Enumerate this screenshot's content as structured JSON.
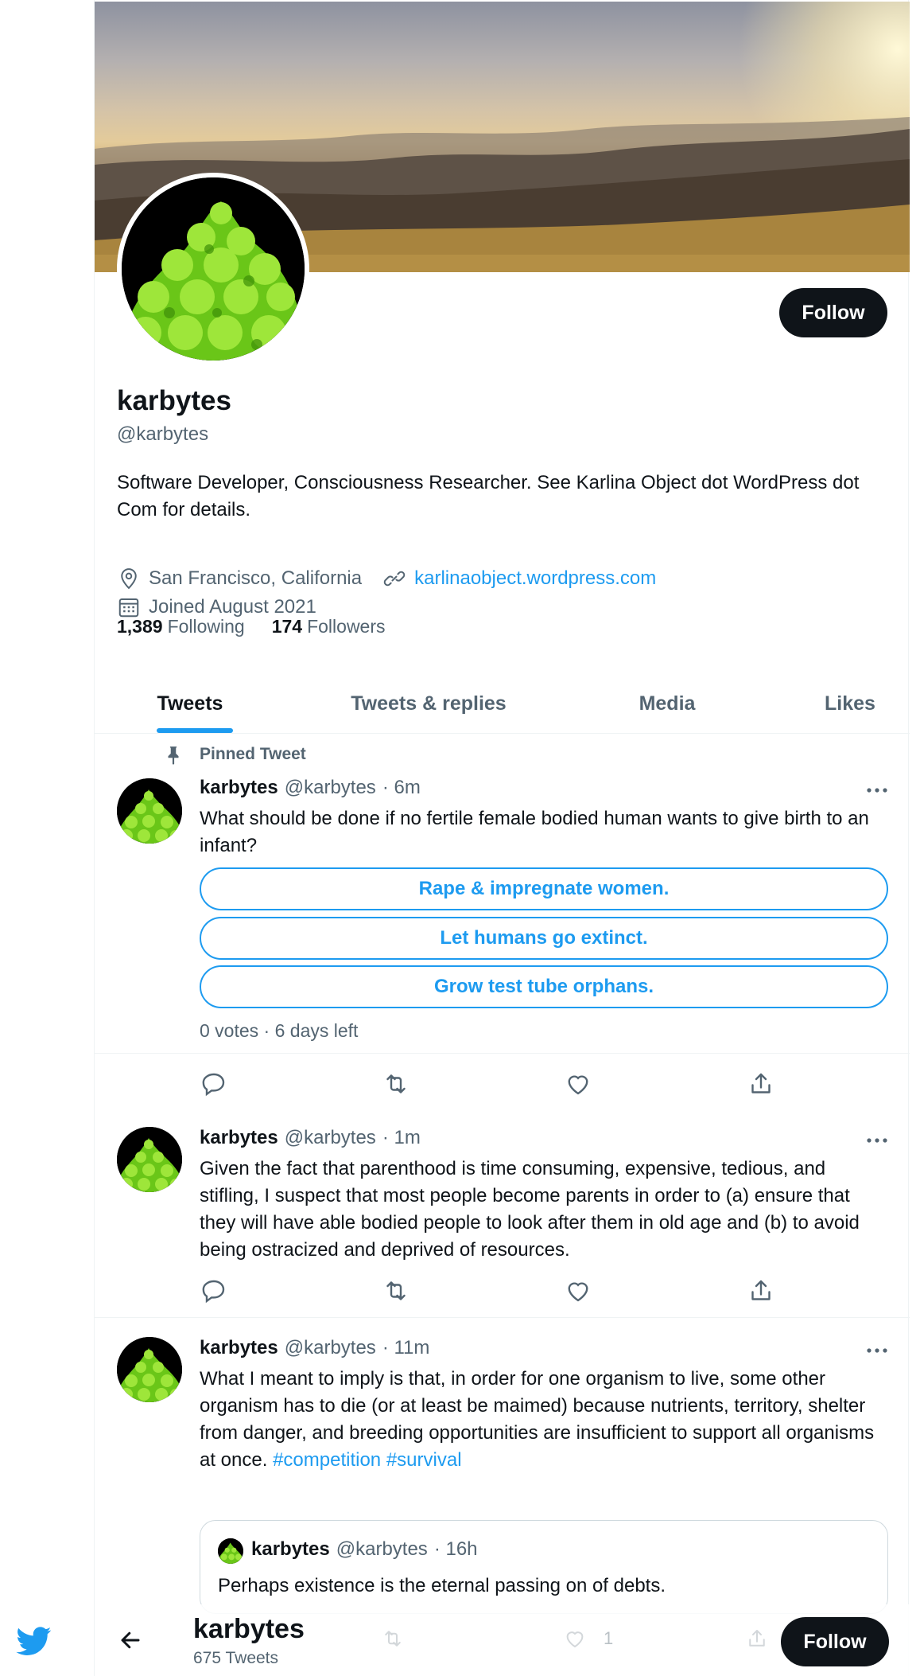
{
  "profile": {
    "name": "karbytes",
    "handle": "@karbytes",
    "bio": "Software Developer, Consciousness Researcher. See Karlina Object dot WordPress dot Com for details.",
    "location": "San Francisco, California",
    "website": "karlinaobject.wordpress.com",
    "joined": "Joined August 2021",
    "following_count": "1,389",
    "following_label": "Following",
    "followers_count": "174",
    "followers_label": "Followers",
    "follow_label": "Follow"
  },
  "tabs": [
    {
      "label": "Tweets",
      "active": true
    },
    {
      "label": "Tweets & replies",
      "active": false
    },
    {
      "label": "Media",
      "active": false
    },
    {
      "label": "Likes",
      "active": false
    }
  ],
  "tweets": [
    {
      "pinned_label": "Pinned Tweet",
      "name": "karbytes",
      "handle": "@karbytes",
      "time": "· 6m",
      "text": "What should be done if no fertile female bodied human wants to give birth to an infant?",
      "poll_options": [
        "Rape & impregnate women.",
        "Let humans go extinct.",
        "Grow test tube orphans."
      ],
      "poll_meta": "0 votes · 6 days left"
    },
    {
      "name": "karbytes",
      "handle": "@karbytes",
      "time": "· 1m",
      "text": "Given the fact that parenthood is time consuming, expensive, tedious, and stifling, I suspect that most people become parents in order to (a) ensure that they will have able bodied people to look after them in old age and (b) to avoid being ostracized and deprived of resources."
    },
    {
      "name": "karbytes",
      "handle": "@karbytes",
      "time": "· 11m",
      "text": "What I meant to imply is that, in order for one organism to live, some other organism has to die (or at least be maimed) because nutrients, territory, shelter from danger, and breeding opportunities are insufficient to support all organisms at once.",
      "hashtags": [
        "#competition",
        "#survival"
      ],
      "quote": {
        "name": "karbytes",
        "handle": "@karbytes",
        "time": "· 16h",
        "text": "Perhaps existence is the eternal passing on of debts."
      },
      "like_count": "1"
    }
  ],
  "bottom_bar": {
    "name": "karbytes",
    "tweet_count": "675 Tweets",
    "follow_label": "Follow"
  },
  "icons": {
    "brand": "twitter-bird-icon",
    "location": "location-pin-icon",
    "link": "link-icon",
    "calendar": "calendar-icon",
    "pin": "pin-icon",
    "reply": "reply-icon",
    "retweet": "retweet-icon",
    "like": "heart-icon",
    "share": "share-icon",
    "more": "more-icon",
    "back": "back-arrow-icon"
  },
  "colors": {
    "accent": "#1d9bf0",
    "text": "#0f1419",
    "muted": "#536471",
    "button": "#0f1419"
  }
}
